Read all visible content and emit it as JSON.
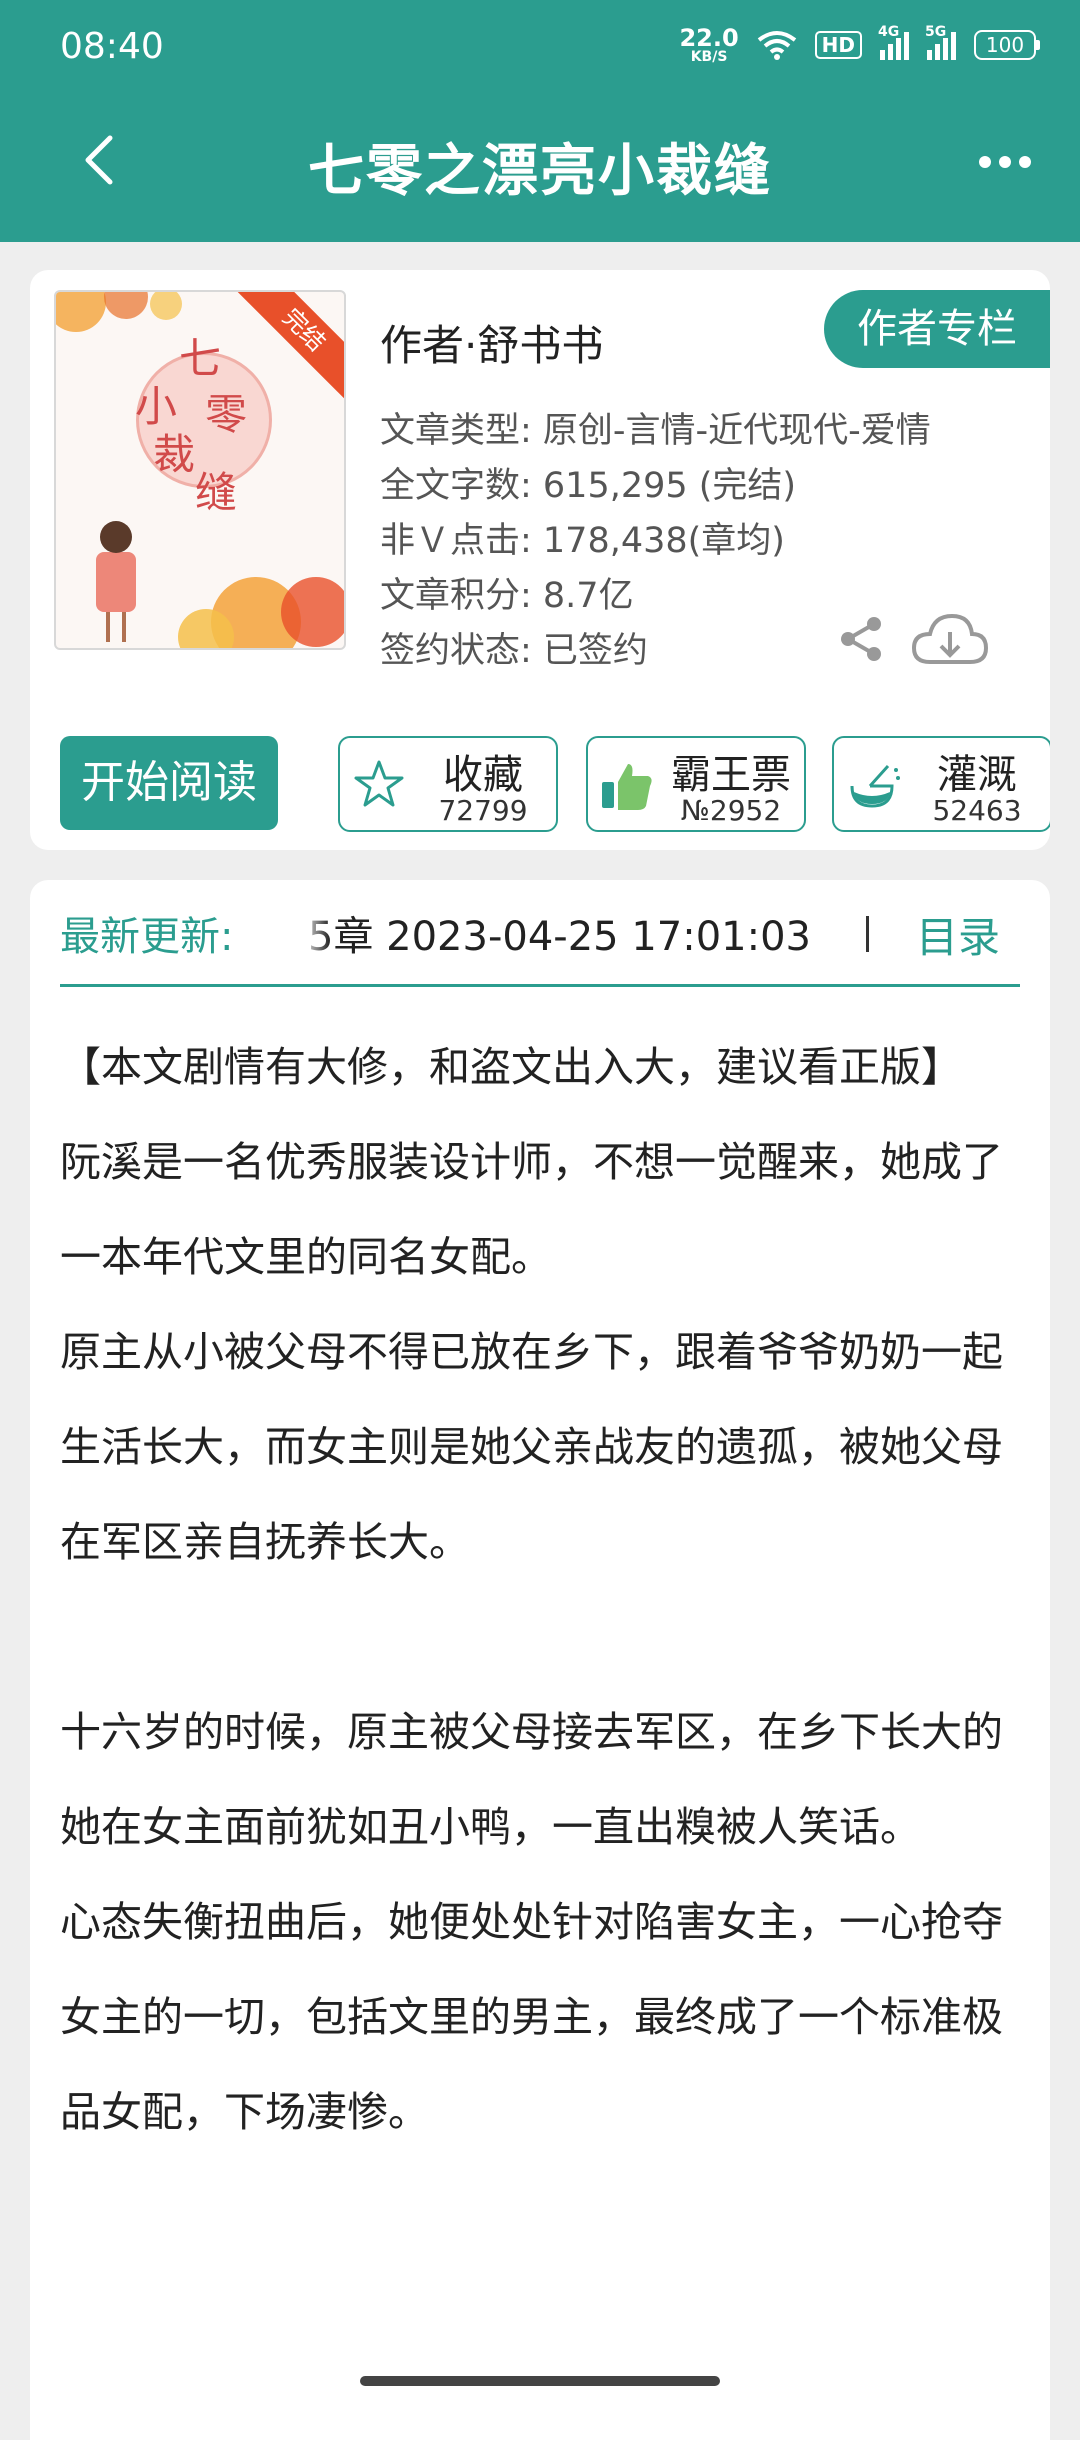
{
  "status_bar": {
    "time": "08:40",
    "net_speed": "22.0",
    "net_unit": "KB/S",
    "hd": "HD",
    "sig1": "4G",
    "sig2": "5G",
    "battery": "100",
    "icons": [
      "wifi-icon",
      "signal-icon",
      "battery-icon"
    ]
  },
  "header": {
    "title": "七零之漂亮小裁缝",
    "back_icon": "chevron-left-icon",
    "more_icon": "more-horizontal-icon"
  },
  "book": {
    "cover_title_chars": [
      "七",
      "小",
      "零",
      "裁",
      "缝"
    ],
    "cover_badge": "完结",
    "author": "作者·舒书书",
    "author_column_label": "作者专栏",
    "meta": [
      "文章类型: 原创-言情-近代现代-爱情",
      "全文字数: 615,295 (完结)",
      "非Ｖ点击: 178,438(章均)",
      "文章积分: 8.7亿",
      "签约状态: 已签约"
    ],
    "read_button": "开始阅读",
    "collect": {
      "label": "收藏",
      "count": "72799"
    },
    "vote": {
      "label": "霸王票",
      "count": "№2952"
    },
    "nourish": {
      "label": "灌溉",
      "count": "52463"
    }
  },
  "update": {
    "label": "最新更新:",
    "value": "5章  2023-04-25 17:01:03",
    "toc_label": "目录"
  },
  "synopsis": [
    "【本文剧情有大修，和盗文出入大，建议看正版】",
    "阮溪是一名优秀服装设计师，不想一觉醒来，她成了一本年代文里的同名女配。",
    "原主从小被父母不得已放在乡下，跟着爷爷奶奶一起生活长大，而女主则是她父亲战友的遗孤，被她父母在军区亲自抚养长大。",
    "",
    "十六岁的时候，原主被父母接去军区，在乡下长大的她在女主面前犹如丑小鸭，一直出糗被人笑话。",
    "心态失衡扭曲后，她便处处针对陷害女主，一心抢夺女主的一切，包括文里的男主，最终成了一个标准极品女配，下场凄惨。"
  ],
  "colors": {
    "accent": "#2b9d8f",
    "badge": "#e8502a"
  }
}
